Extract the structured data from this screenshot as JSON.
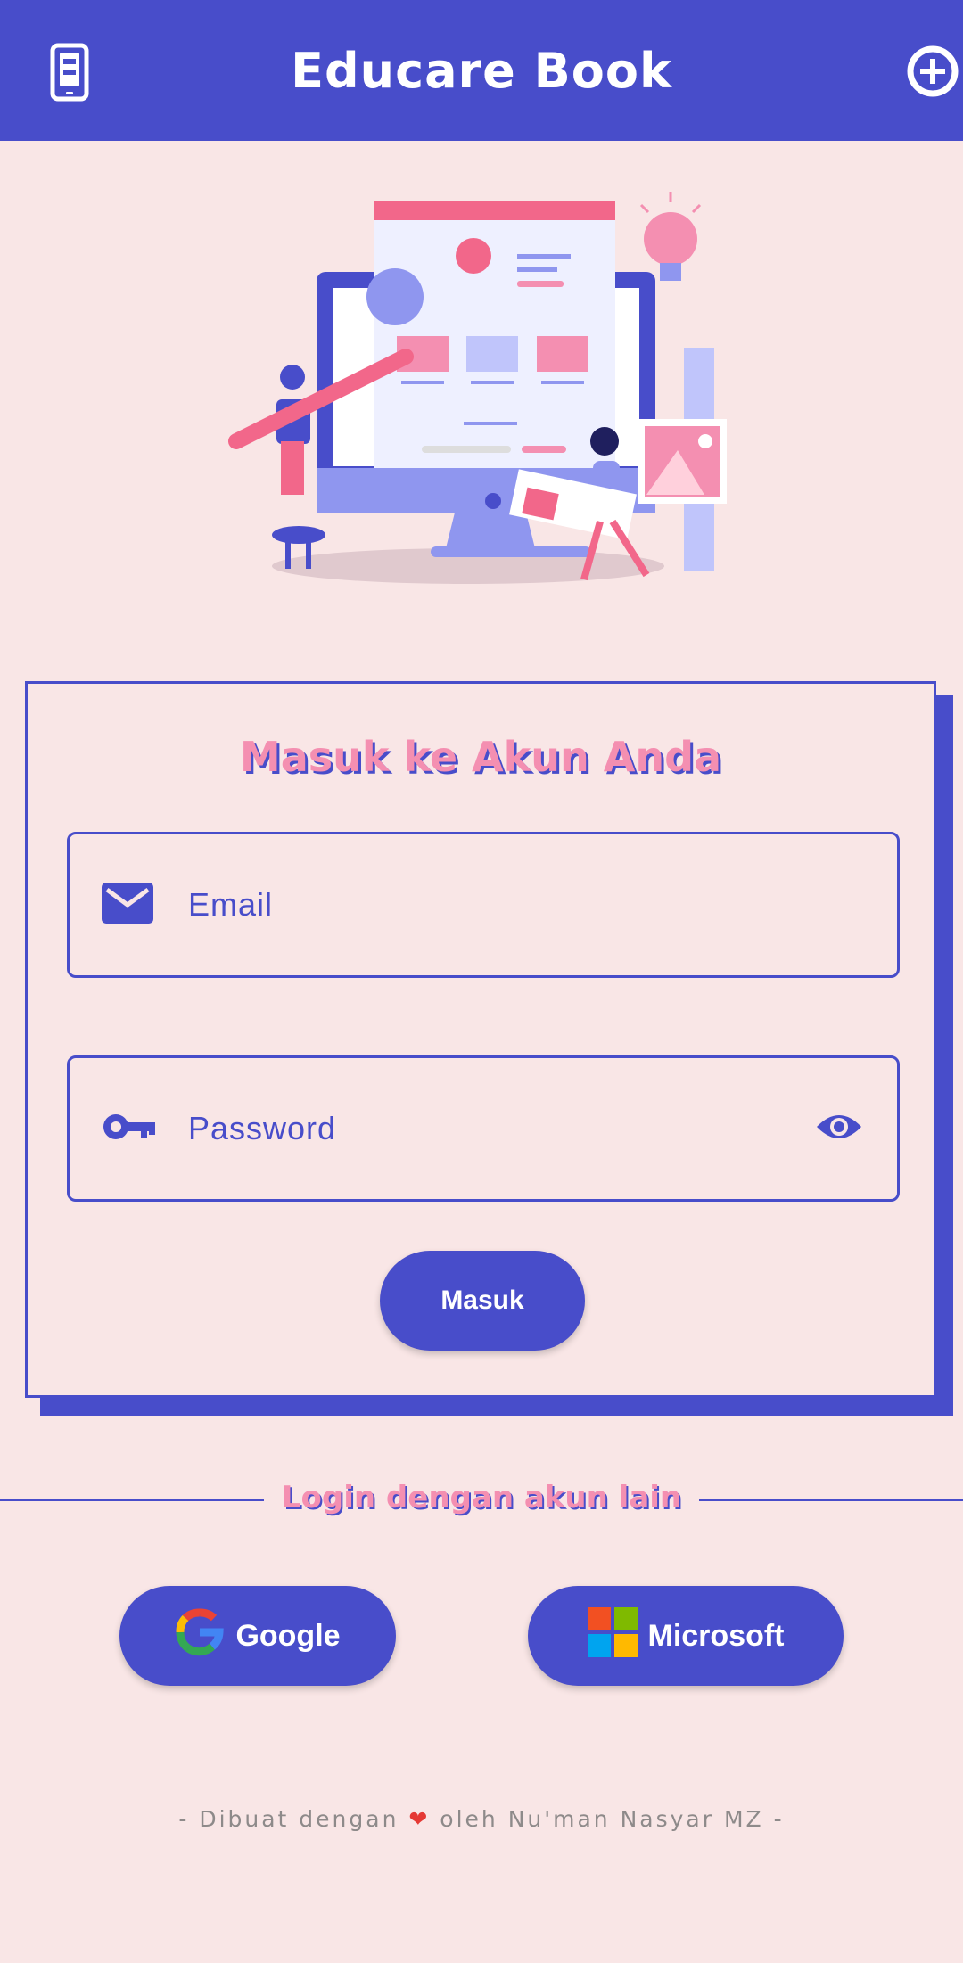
{
  "app_bar": {
    "title": "Educare Book",
    "left_icon": "book-phone-icon",
    "right_icon": "add-circle-icon"
  },
  "illustration": {
    "icon": "web-design-illustration"
  },
  "login_card": {
    "title": "Masuk ke Akun Anda",
    "email": {
      "placeholder": "Email",
      "icon": "mail-icon"
    },
    "password": {
      "placeholder": "Password",
      "icon": "key-icon",
      "toggle_icon": "eye-icon"
    },
    "submit_label": "Masuk"
  },
  "alt_login": {
    "label": "Login dengan akun lain",
    "google_label": "Google",
    "microsoft_label": "Microsoft"
  },
  "footer": {
    "prefix": "- Dibuat dengan ",
    "heart": "❤",
    "suffix": " oleh Nu'man Nasyar MZ -"
  },
  "colors": {
    "primary": "#484DCA",
    "background": "#F9E6E6",
    "accent_pink": "#F48FB1"
  }
}
